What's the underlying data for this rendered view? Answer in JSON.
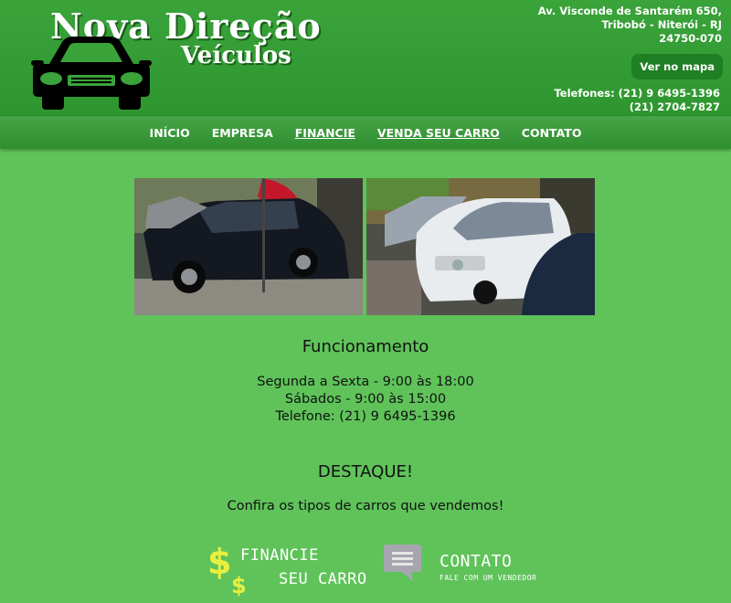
{
  "header": {
    "logo_line1": "Nova Direção",
    "logo_line2": "Veículos",
    "address_line1": "Av. Visconde de Santarém 650,",
    "address_line2": "Tribobó - Niterói - RJ",
    "address_line3": "24750-070",
    "map_button": "Ver no mapa",
    "phones_line1": "Telefones: (21) 9 6495-1396",
    "phones_line2": "(21) 2704-7827"
  },
  "nav": {
    "items": [
      "INÍCIO",
      "EMPRESA",
      "FINANCIE",
      "VENDA SEU CARRO",
      "CONTATO"
    ]
  },
  "hours": {
    "title": "Funcionamento",
    "line1": "Segunda a Sexta - 9:00 às 18:00",
    "line2": "Sábados - 9:00 às 15:00",
    "line3": "Telefone: (21) 9 6495-1396"
  },
  "featured": {
    "title": "DESTAQUE!",
    "subtitle": "Confira os tipos de carros que vendemos!"
  },
  "promos": {
    "finance_line1": "FINANCIE",
    "finance_line2": "SEU CARRO",
    "contact_title": "CONTATO",
    "contact_sub": "FALE COM UM VENDEDOR"
  },
  "colors": {
    "page_bg": "#5fc35a",
    "header_bg": "#3aa33a",
    "button_bg": "#1f7f24",
    "dollar_yellow": "#e8f040"
  }
}
